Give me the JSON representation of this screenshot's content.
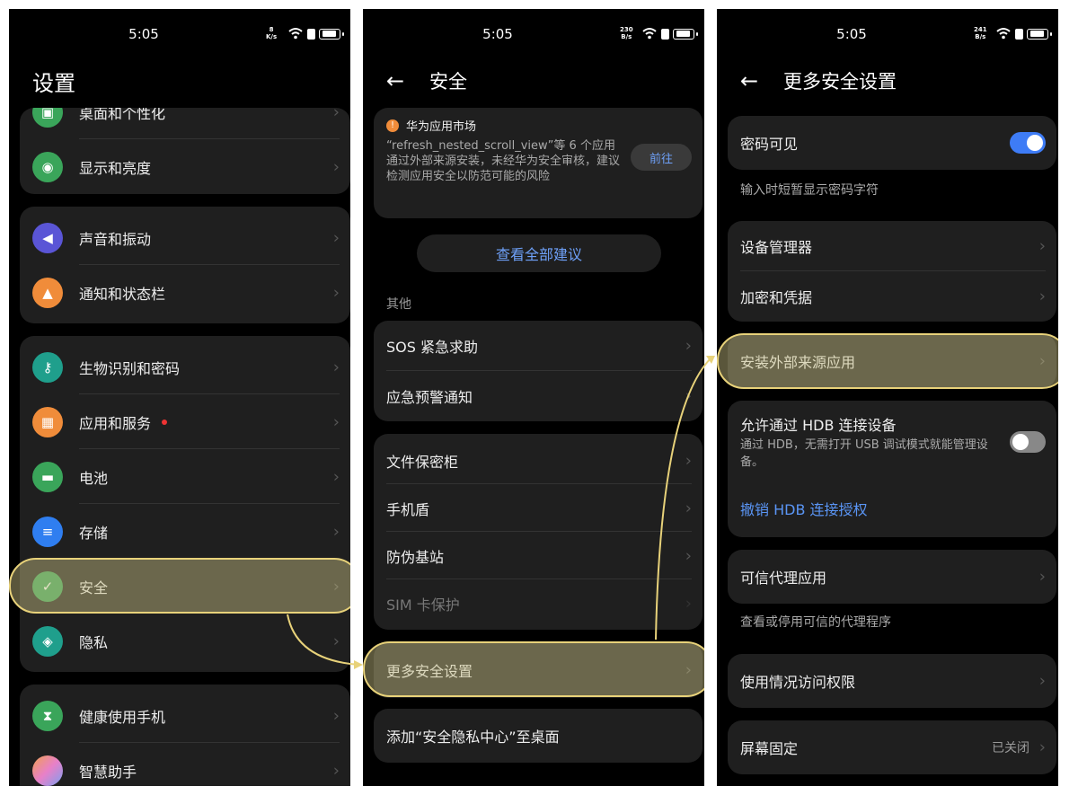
{
  "colors": {
    "accent_blue": "#3e7cf6",
    "highlight": "#e8d27a",
    "card_bg": "#1f1f1f"
  },
  "screen1": {
    "status": {
      "time": "5:05",
      "speed_top": "8",
      "speed_bottom": "K/s"
    },
    "title": "设置",
    "items": [
      {
        "label": "桌面和个性化",
        "icon": "wallpaper-icon",
        "color": "#3aa55a"
      },
      {
        "label": "显示和亮度",
        "icon": "eye-icon",
        "color": "#3aa55a"
      },
      {
        "label": "声音和振动",
        "icon": "speaker-icon",
        "color": "#5a55d6"
      },
      {
        "label": "通知和状态栏",
        "icon": "bell-icon",
        "color": "#f08c3a"
      },
      {
        "label": "生物识别和密码",
        "icon": "key-icon",
        "color": "#1f9f8c"
      },
      {
        "label": "应用和服务",
        "icon": "apps-icon",
        "color": "#f08c3a"
      },
      {
        "label": "电池",
        "icon": "battery-icon",
        "color": "#3aa55a"
      },
      {
        "label": "存储",
        "icon": "storage-icon",
        "color": "#2f7ef0"
      },
      {
        "label": "安全",
        "icon": "shield-icon",
        "color": "#3aa55a"
      },
      {
        "label": "隐私",
        "icon": "privacy-icon",
        "color": "#1f9f8c"
      },
      {
        "label": "健康使用手机",
        "icon": "hourglass-icon",
        "color": "#3aa55a"
      },
      {
        "label": "智慧助手",
        "icon": "assistant-icon",
        "color": "#e880c8"
      }
    ]
  },
  "screen2": {
    "status": {
      "time": "5:05",
      "speed_top": "230",
      "speed_bottom": "B/s"
    },
    "title": "安全",
    "notice": {
      "source": "华为应用市场",
      "text": "“refresh_nested_scroll_view”等 6 个应用通过外部来源安装，未经华为安全审核，建议检测应用安全以防范可能的风险",
      "button": "前往"
    },
    "view_all": "查看全部建议",
    "section_other": "其他",
    "group1": [
      "SOS 紧急求助",
      "应急预警通知"
    ],
    "group2": [
      "文件保密柜",
      "手机盾",
      "防伪基站",
      "SIM 卡保护"
    ],
    "more_security": "更多安全设置",
    "add_to_desktop": "添加“安全隐私中心”至桌面"
  },
  "screen3": {
    "status": {
      "time": "5:05",
      "speed_top": "241",
      "speed_bottom": "B/s"
    },
    "title": "更多安全设置",
    "password_visible": {
      "label": "密码可见",
      "desc": "输入时短暂显示密码字符",
      "on": true
    },
    "group1": [
      "设备管理器",
      "加密和凭据"
    ],
    "install_external": "安装外部来源应用",
    "hdb": {
      "label": "允许通过 HDB 连接设备",
      "desc": "通过 HDB，无需打开 USB 调试模式就能管理设备。",
      "revoke": "撤销 HDB 连接授权",
      "on": false
    },
    "trusted_agents": {
      "label": "可信代理应用",
      "desc": "查看或停用可信的代理程序"
    },
    "usage_access": "使用情况访问权限",
    "screen_pin": {
      "label": "屏幕固定",
      "value": "已关闭"
    }
  }
}
